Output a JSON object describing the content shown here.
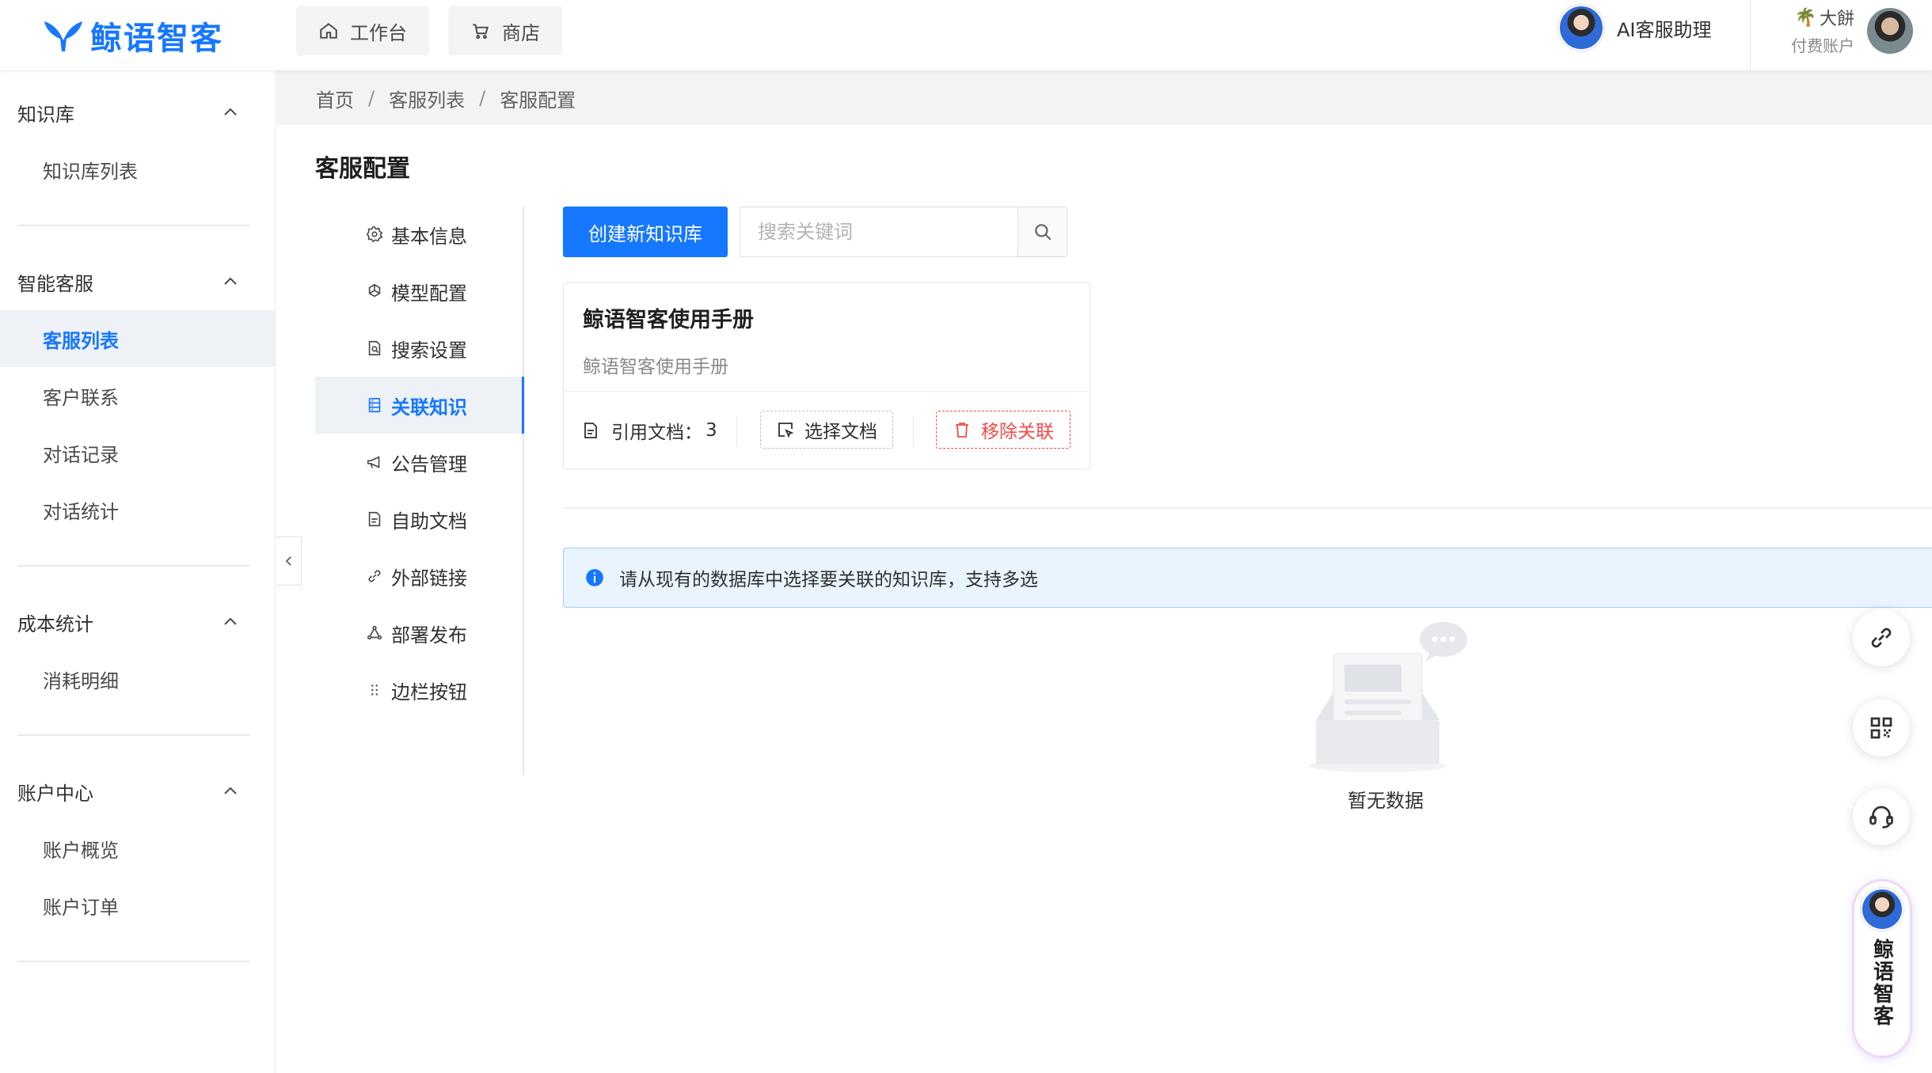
{
  "app": {
    "brand": "鲸语智客",
    "brand_color": "#1677ff"
  },
  "topnav": {
    "workbench": "工作台",
    "store": "商店"
  },
  "assistant": {
    "label": "AI客服助理"
  },
  "user": {
    "name": "大餅",
    "plan": "付费账户"
  },
  "sidebar": {
    "groups": [
      {
        "title": "知识库",
        "items": [
          "知识库列表"
        ]
      },
      {
        "title": "智能客服",
        "items": [
          "客服列表",
          "客户联系",
          "对话记录",
          "对话统计"
        ]
      },
      {
        "title": "成本统计",
        "items": [
          "消耗明细"
        ]
      },
      {
        "title": "账户中心",
        "items": [
          "账户概览",
          "账户订单"
        ]
      }
    ],
    "active_item": "客服列表"
  },
  "breadcrumb": {
    "home": "首页",
    "list": "客服列表",
    "current": "客服配置"
  },
  "page": {
    "title": "客服配置"
  },
  "submenu": {
    "items": [
      "基本信息",
      "模型配置",
      "搜索设置",
      "关联知识",
      "公告管理",
      "自助文档",
      "外部链接",
      "部署发布",
      "边栏按钮"
    ],
    "active_item": "关联知识"
  },
  "toolbar": {
    "create_label": "创建新知识库",
    "search_placeholder": "搜索关键词"
  },
  "knowledge_card": {
    "title": "鲸语智客使用手册",
    "description": "鲸语智客使用手册",
    "ref_label": "引用文档：",
    "ref_count": "3",
    "choose_label": "选择文档",
    "remove_label": "移除关联"
  },
  "alert": {
    "text": "请从现有的数据库中选择要关联的知识库，支持多选"
  },
  "empty": {
    "text": "暂无数据"
  },
  "float_bot": {
    "label": "鲸语智客"
  }
}
